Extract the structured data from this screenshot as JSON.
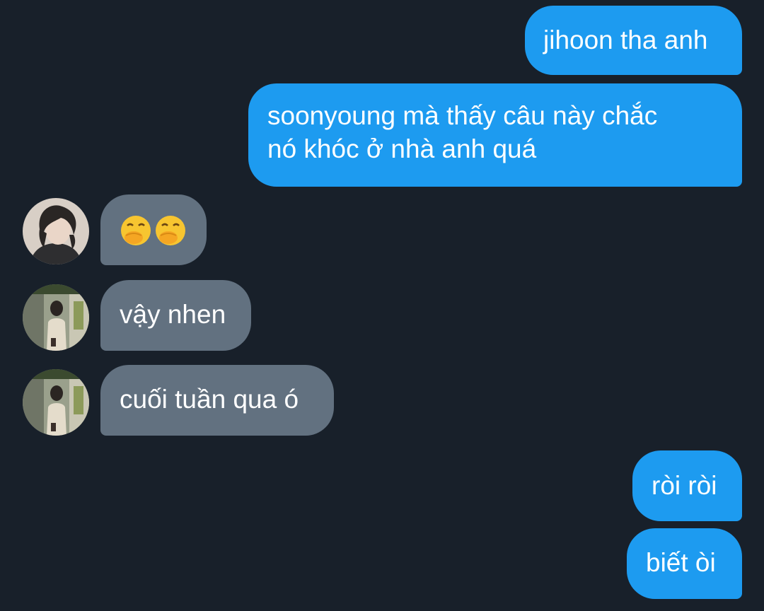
{
  "colors": {
    "background": "#18202a",
    "outgoing_bubble": "#1d9bf0",
    "incoming_bubble": "#627180",
    "text": "#ffffff"
  },
  "messages": [
    {
      "direction": "outgoing",
      "text": "jihoon tha anh"
    },
    {
      "direction": "outgoing",
      "lines": [
        "soonyoung mà thấy câu này chắc",
        "nó khóc ở nhà anh quá"
      ]
    },
    {
      "direction": "incoming",
      "sender_avatar": "avatar-portrait-light",
      "emoji": [
        "face-with-hand-over-mouth-icon",
        "face-with-hand-over-mouth-icon"
      ]
    },
    {
      "direction": "incoming",
      "sender_avatar": "avatar-photo-subway",
      "text": "vậy nhen"
    },
    {
      "direction": "incoming",
      "sender_avatar": "avatar-photo-subway",
      "text": "cuối tuần qua ó"
    },
    {
      "direction": "outgoing",
      "text": "ròi ròi"
    },
    {
      "direction": "outgoing",
      "text": "biết òi"
    }
  ]
}
